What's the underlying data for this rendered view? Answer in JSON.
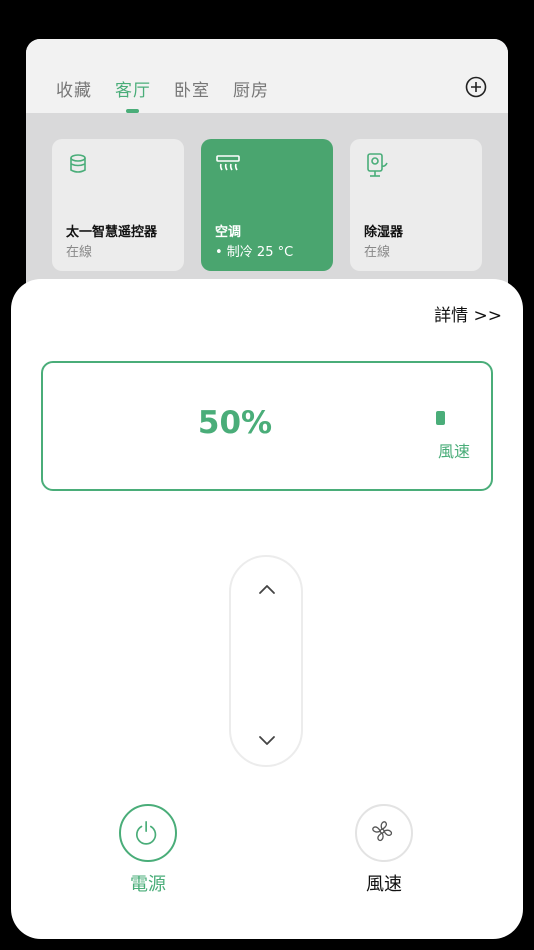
{
  "tabs": [
    {
      "label": "收藏",
      "active": false
    },
    {
      "label": "客厅",
      "active": true
    },
    {
      "label": "卧室",
      "active": false
    },
    {
      "label": "厨房",
      "active": false
    }
  ],
  "devices": [
    {
      "name": "太一智慧遥控器",
      "status": "在線",
      "icon": "remote-cylinder-icon",
      "active": false
    },
    {
      "name": "空调",
      "status": "• 制冷 25 °C",
      "icon": "air-conditioner-icon",
      "active": true
    },
    {
      "name": "除湿器",
      "status": "在線",
      "icon": "dehumidifier-icon",
      "active": false
    }
  ],
  "sheet": {
    "details": "詳情 >>",
    "speed_value": "50%",
    "speed_label": "風速",
    "power_label": "電源",
    "fan_label": "風速"
  },
  "colors": {
    "accent": "#4aad79",
    "active_card": "#4aa56f"
  }
}
